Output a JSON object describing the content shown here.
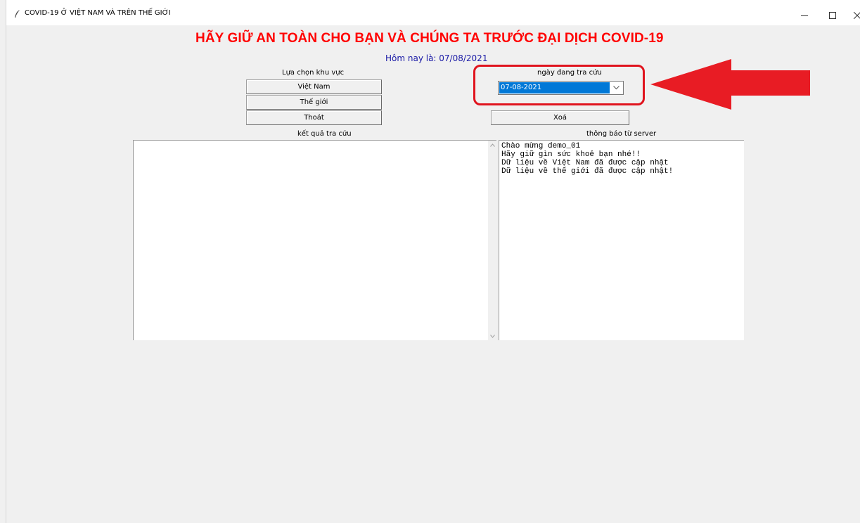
{
  "window": {
    "title": "COVID-19 Ở VIỆT NAM VÀ TRÊN THẾ GIỚI",
    "icon": "feather-icon",
    "controls": [
      "minimize-icon",
      "maximize-icon",
      "close-icon"
    ]
  },
  "header": {
    "headline": "HÃY GIỮ AN TOÀN CHO BẠN VÀ CHÚNG TA TRƯỚC ĐẠI DỊCH COVID-19",
    "today": "Hôm nay là: 07/08/2021"
  },
  "region": {
    "label": "Lựa chọn khu vực",
    "buttons": [
      "Việt Nam",
      "Thế giới",
      "Thoát"
    ]
  },
  "date_picker": {
    "label": "ngày đang tra cứu",
    "selected": "07-08-2021"
  },
  "actions": {
    "clear_label": "Xoá"
  },
  "results": {
    "label": "kết quả tra cứu"
  },
  "server": {
    "label": "thông báo từ server",
    "messages": [
      "Chào mừng demo_01",
      "Hãy giữ gìn sức khoẻ bạn nhé!!",
      "Dữ liệu về Việt Nam đã được cập nhật",
      "Dữ liệu về thế giới đã được cập nhật!"
    ]
  },
  "colors": {
    "headline": "#ff0000",
    "today": "#1a1aa6",
    "selection": "#0078d7",
    "annotation": "#e0141e"
  }
}
